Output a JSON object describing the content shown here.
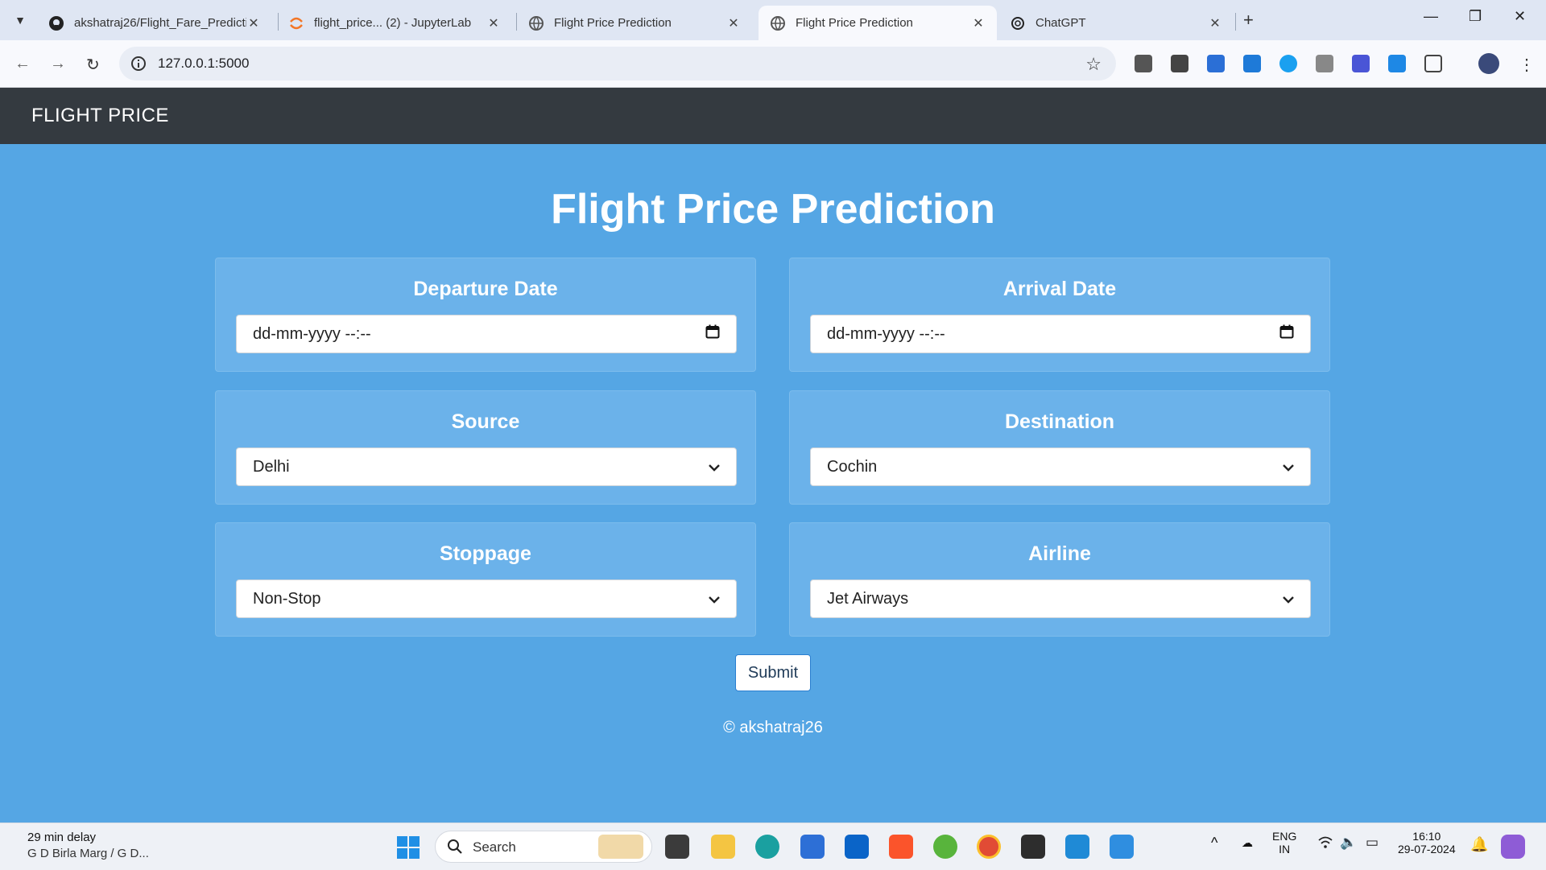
{
  "browser": {
    "tabs": [
      {
        "title": "akshatraj26/Flight_Fare_Predicti",
        "icon": "github-icon"
      },
      {
        "title": "flight_price... (2) - JupyterLab",
        "icon": "jupyter-icon"
      },
      {
        "title": "Flight Price Prediction",
        "icon": "globe-icon"
      },
      {
        "title": "Flight Price Prediction",
        "icon": "globe-icon",
        "active": true
      },
      {
        "title": "ChatGPT",
        "icon": "chatgpt-icon"
      }
    ],
    "url": "127.0.0.1:5000"
  },
  "navbar": {
    "brand": "FLIGHT PRICE"
  },
  "main": {
    "title": "Flight Price Prediction",
    "fields": {
      "departure": {
        "label": "Departure Date",
        "value": "dd-mm-yyyy --:--"
      },
      "arrival": {
        "label": "Arrival Date",
        "value": "dd-mm-yyyy --:--"
      },
      "source": {
        "label": "Source",
        "value": "Delhi"
      },
      "destination": {
        "label": "Destination",
        "value": "Cochin"
      },
      "stoppage": {
        "label": "Stoppage",
        "value": "Non-Stop"
      },
      "airline": {
        "label": "Airline",
        "value": "Jet Airways"
      }
    },
    "submit_label": "Submit",
    "footer": "© akshatraj26"
  },
  "taskbar": {
    "weather_line1": "29 min delay",
    "weather_line2": "G D Birla Marg / G D...",
    "search_placeholder": "Search",
    "lang_line1": "ENG",
    "lang_line2": "IN",
    "time": "16:10",
    "date": "29-07-2024"
  },
  "colors": {
    "page_bg": "#55a6e4",
    "card_bg": "#6bb2ea",
    "navbar_bg": "#343a40"
  }
}
